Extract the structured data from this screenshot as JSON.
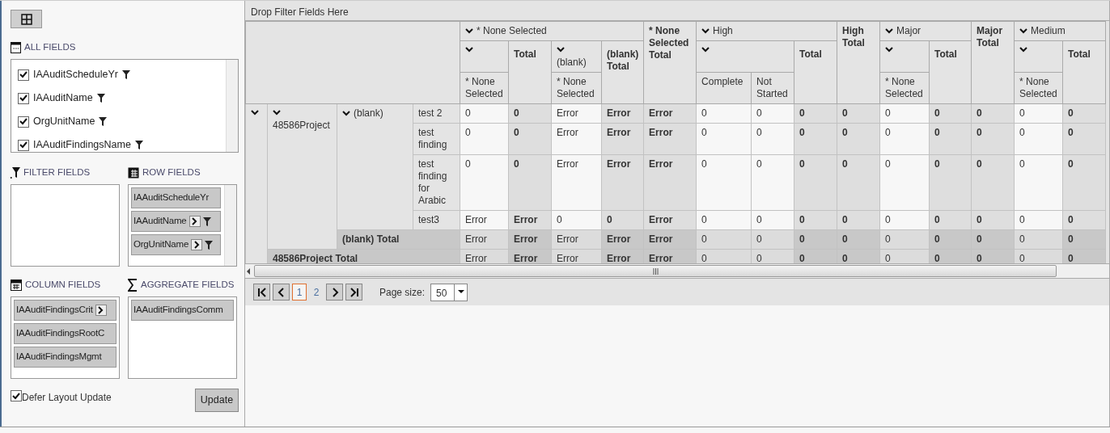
{
  "all_fields": {
    "title": "ALL FIELDS",
    "items": [
      {
        "label": "IAAuditScheduleYr",
        "checked": true
      },
      {
        "label": "IAAuditName",
        "checked": true
      },
      {
        "label": "OrgUnitName",
        "checked": true
      },
      {
        "label": "IAAuditFindingsName",
        "checked": true
      }
    ]
  },
  "filter_fields": {
    "title": "FILTER FIELDS"
  },
  "row_fields": {
    "title": "ROW FIELDS",
    "items": [
      {
        "label": "IAAuditScheduleYr",
        "expand_button": false,
        "filter": false
      },
      {
        "label": "IAAuditName",
        "expand_button": true,
        "filter": true
      },
      {
        "label": "OrgUnitName",
        "expand_button": true,
        "filter": true
      }
    ]
  },
  "column_fields": {
    "title": "COLUMN FIELDS",
    "items": [
      {
        "label": "IAAuditFindingsCrit",
        "expand_button": true
      },
      {
        "label": "IAAuditFindingsRootC",
        "expand_button": false
      },
      {
        "label": "IAAuditFindingsMgmt",
        "expand_button": false
      }
    ]
  },
  "aggregate_fields": {
    "title": "AGGREGATE FIELDS",
    "items": [
      {
        "label": "IAAuditFindingsComm"
      }
    ]
  },
  "defer_layout_update": {
    "label": "Defer Layout Update",
    "checked": true
  },
  "update_button": "Update",
  "pivot": {
    "filter_drop_hint": "Drop Filter Fields Here",
    "columns": [
      {
        "label": "* None Selected",
        "expanded": true,
        "children": [
          {
            "expanded": true,
            "children": [
              {
                "label": "* None Selected"
              }
            ]
          },
          {
            "label": "Total",
            "kind": "total"
          },
          {
            "label": "(blank)",
            "expanded": true,
            "children": [
              {
                "label": "* None Selected"
              }
            ]
          },
          {
            "label": "(blank) Total",
            "kind": "total"
          }
        ]
      },
      {
        "label": "* None Selected Total",
        "kind": "total"
      },
      {
        "label": "High",
        "expanded": true,
        "children": [
          {
            "expanded": true,
            "children": [
              {
                "label": "Complete"
              },
              {
                "label": "Not Started"
              }
            ]
          },
          {
            "label": "Total",
            "kind": "total"
          }
        ]
      },
      {
        "label": "High Total",
        "kind": "total"
      },
      {
        "label": "Major",
        "expanded": true,
        "children": [
          {
            "expanded": true,
            "children": [
              {
                "label": "* None Selected"
              }
            ]
          },
          {
            "label": "Total",
            "kind": "total"
          }
        ]
      },
      {
        "label": "Major Total",
        "kind": "total"
      },
      {
        "label": "Medium",
        "expanded": true,
        "children": [
          {
            "expanded": true,
            "children": [
              {
                "label": "* None Selected"
              }
            ]
          },
          {
            "label": "Total",
            "kind": "total"
          }
        ]
      }
    ],
    "rows": [
      {
        "expanded": true,
        "children": [
          {
            "label": "48586Project",
            "expanded": true,
            "children": [
              {
                "label": "(blank)",
                "expanded": true,
                "children": [
                  {
                    "label": "test 2",
                    "values": [
                      "0",
                      "0",
                      "Error",
                      "Error",
                      "Error",
                      "0",
                      "0",
                      "0",
                      "0",
                      "0",
                      "0",
                      "0",
                      "0",
                      "0"
                    ]
                  },
                  {
                    "label": "test finding",
                    "values": [
                      "0",
                      "0",
                      "Error",
                      "Error",
                      "Error",
                      "0",
                      "0",
                      "0",
                      "0",
                      "0",
                      "0",
                      "0",
                      "0",
                      "0"
                    ]
                  },
                  {
                    "label": "test finding for Arabic",
                    "values": [
                      "0",
                      "0",
                      "Error",
                      "Error",
                      "Error",
                      "0",
                      "0",
                      "0",
                      "0",
                      "0",
                      "0",
                      "0",
                      "0",
                      "0"
                    ]
                  },
                  {
                    "label": "test3",
                    "values": [
                      "Error",
                      "Error",
                      "0",
                      "0",
                      "Error",
                      "0",
                      "0",
                      "0",
                      "0",
                      "0",
                      "0",
                      "0",
                      "0",
                      "0"
                    ]
                  }
                ],
                "total": {
                  "label": "(blank) Total",
                  "values": [
                    "Error",
                    "Error",
                    "Error",
                    "Error",
                    "Error",
                    "0",
                    "0",
                    "0",
                    "0",
                    "0",
                    "0",
                    "0",
                    "0",
                    "0"
                  ]
                }
              }
            ],
            "total": {
              "label": "48586Project Total",
              "values": [
                "Error",
                "Error",
                "Error",
                "Error",
                "Error",
                "0",
                "0",
                "0",
                "0",
                "0",
                "0",
                "0",
                "0",
                "0"
              ]
            }
          }
        ]
      }
    ]
  },
  "pager": {
    "pages": [
      {
        "label": "1",
        "selected": true
      },
      {
        "label": "2",
        "selected": false
      }
    ],
    "page_size_label": "Page size:",
    "page_size": "50"
  }
}
